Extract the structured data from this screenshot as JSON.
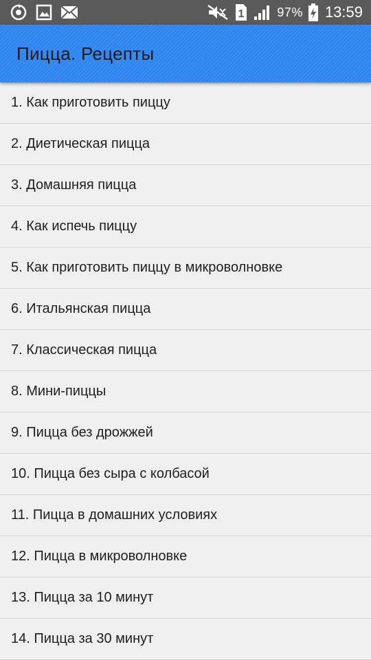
{
  "status_bar": {
    "battery_percent": "97%",
    "time": "13:59",
    "sim_slot": "1",
    "icons": [
      "sync-icon",
      "image-icon",
      "mail-icon",
      "mute-icon",
      "sim-icon",
      "signal-icon",
      "battery-charging-icon"
    ]
  },
  "app_bar": {
    "title": "Пицца. Рецепты",
    "color": "#2f86f0"
  },
  "recipes": [
    "1. Как приготовить пиццу",
    "2. Диетическая пицца",
    "3. Домашняя пицца",
    "4. Как испечь пиццу",
    "5. Как приготовить пиццу в микроволновке",
    "6. Итальянская пицца",
    "7. Классическая пицца",
    "8. Мини-пиццы",
    "9. Пицца без дрожжей",
    "10. Пицца без сыра с колбасой",
    "11. Пицца в домашних условиях",
    "12. Пицца в микроволновке",
    "13. Пицца за 10 минут",
    "14. Пицца за 30 минут"
  ]
}
